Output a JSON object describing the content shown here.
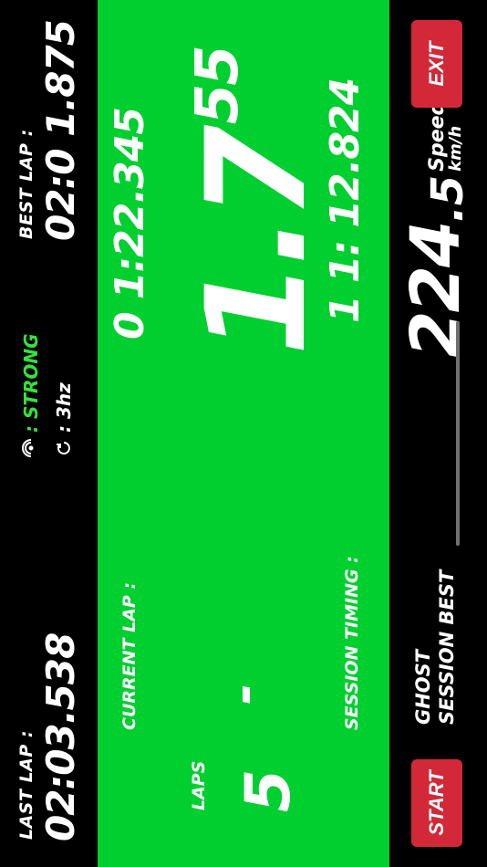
{
  "last_lap": {
    "label": "LAST LAP :",
    "value": "02:03.538"
  },
  "best_lap": {
    "label": "BEST LAP :",
    "value": "02:0 1.875"
  },
  "gps": {
    "signal_label": ": STRONG",
    "rate_label": ": 3hz"
  },
  "center": {
    "laps_label": "LAPS",
    "laps_value": "5",
    "current_lap_label": "CURRENT LAP :",
    "current_lap_value": "-",
    "delta_main": "1.7",
    "delta_sub": "55",
    "reference_time": "0 1:22.345",
    "session_timing_label": "SESSION TIMING :",
    "session_time": "1 1: 12.824"
  },
  "bottom": {
    "start_label": "START",
    "exit_label": "EXIT",
    "ghost_line1": "GHOST",
    "ghost_line2": "SESSION BEST",
    "speed_int": "224",
    "speed_dec": ".5",
    "speed_label": "Speed",
    "speed_unit": "km/h"
  },
  "colors": {
    "background": "#000000",
    "panel": "#00cf30",
    "button": "#d32838",
    "signal": "#35e23a",
    "text": "#ffffff"
  }
}
